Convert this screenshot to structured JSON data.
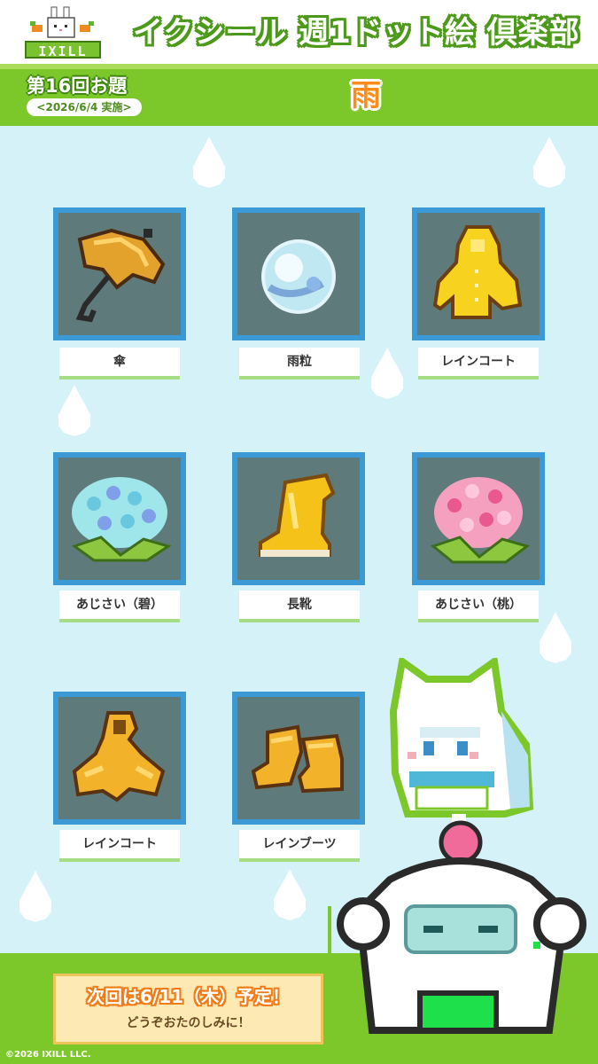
{
  "header": {
    "logo_text": "IXILL",
    "title": "イクシール 週1ドット絵 倶楽部"
  },
  "theme": {
    "round_label": "第16回お題",
    "round_date": "<2026/6/4 実施>",
    "word": "雨"
  },
  "items": [
    {
      "label": "傘",
      "icon": "umbrella-icon"
    },
    {
      "label": "雨粒",
      "icon": "raindrop-icon"
    },
    {
      "label": "レインコート",
      "icon": "yellow-raincoat-icon"
    },
    {
      "label": "あじさい（碧）",
      "icon": "blue-hydrangea-icon"
    },
    {
      "label": "長靴",
      "icon": "rain-boot-icon"
    },
    {
      "label": "あじさい（桃）",
      "icon": "pink-hydrangea-icon"
    },
    {
      "label": "レインコート",
      "icon": "orange-raincoat-icon"
    },
    {
      "label": "レインブーツ",
      "icon": "rain-boots-icon"
    }
  ],
  "footer": {
    "next_title": "次回は6/11（木）予定！",
    "next_sub": "どうぞおたのしみに！",
    "copyright": "©2026 IXILL LLC."
  },
  "colors": {
    "accent_green": "#7cc82a",
    "background": "#d5f2f9",
    "tile_border": "#3b9ad6",
    "theme_word": "#ff8c1a"
  }
}
